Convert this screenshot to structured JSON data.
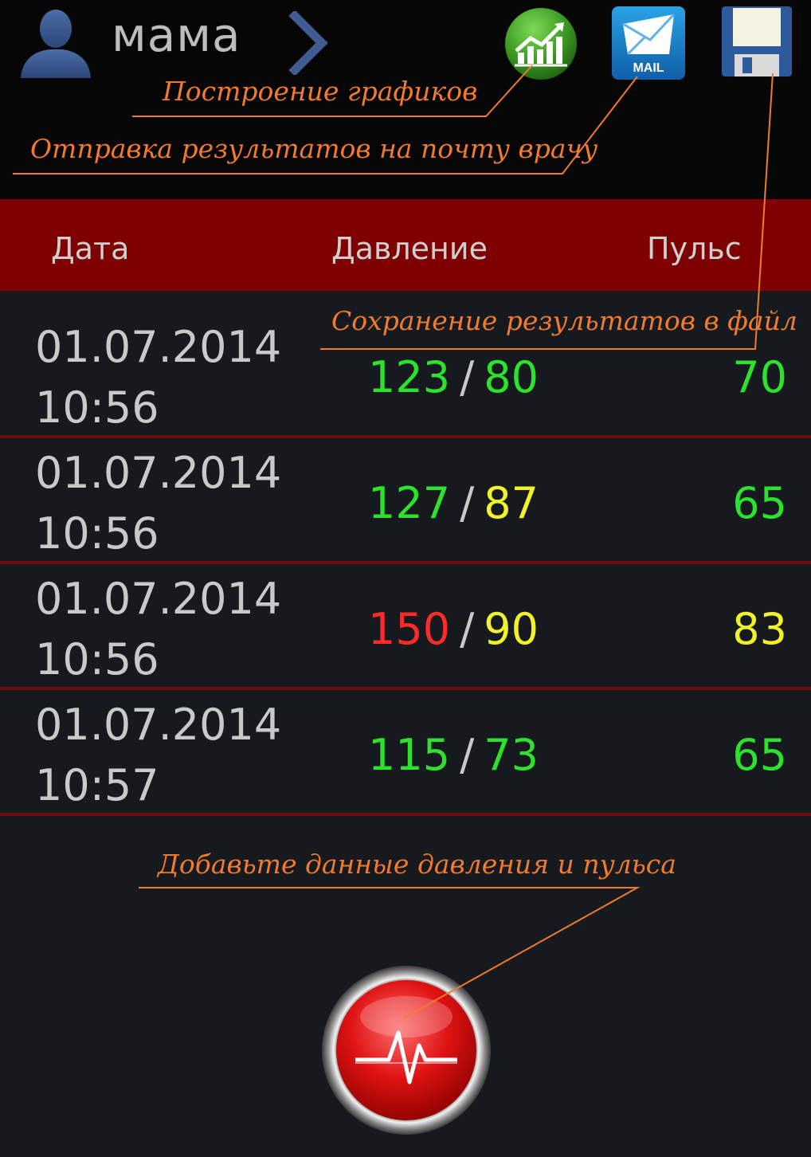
{
  "profile": {
    "name": "мама"
  },
  "table": {
    "headers": {
      "date": "Дата",
      "pressure": "Давление",
      "pulse": "Пульс"
    },
    "rows": [
      {
        "date": "01.07.2014",
        "time": "10:56",
        "systolic": "123",
        "diastolic": "80",
        "pulse": "70",
        "systolic_color": "#2de22d",
        "diastolic_color": "#2de22d",
        "pulse_color": "#2de22d"
      },
      {
        "date": "01.07.2014",
        "time": "10:56",
        "systolic": "127",
        "diastolic": "87",
        "pulse": "65",
        "systolic_color": "#2de22d",
        "diastolic_color": "#f2f22a",
        "pulse_color": "#2de22d"
      },
      {
        "date": "01.07.2014",
        "time": "10:56",
        "systolic": "150",
        "diastolic": "90",
        "pulse": "83",
        "systolic_color": "#ff2a2a",
        "diastolic_color": "#f2f22a",
        "pulse_color": "#f2f22a"
      },
      {
        "date": "01.07.2014",
        "time": "10:57",
        "systolic": "115",
        "diastolic": "73",
        "pulse": "65",
        "systolic_color": "#2de22d",
        "diastolic_color": "#2de22d",
        "pulse_color": "#2de22d"
      }
    ]
  },
  "icons": {
    "avatar": "user-silhouette-icon",
    "chevron": "chevron-right-icon",
    "chart": "line-chart-icon",
    "mail": "mail-envelope-icon",
    "mail_label": "MAIL",
    "save": "floppy-disk-icon",
    "add": "heartbeat-pulse-icon"
  },
  "annotations": {
    "charts": "Построение графиков",
    "mail": "Отправка результатов на почту врачу",
    "save": "Сохранение результатов в файл",
    "add": "Добавьте данные давления и пульса"
  },
  "colors": {
    "header_bg": "#7f0000",
    "annotation": "#f07a2d",
    "normal": "#2de22d",
    "warning": "#f2f22a",
    "danger": "#ff2a2a"
  }
}
